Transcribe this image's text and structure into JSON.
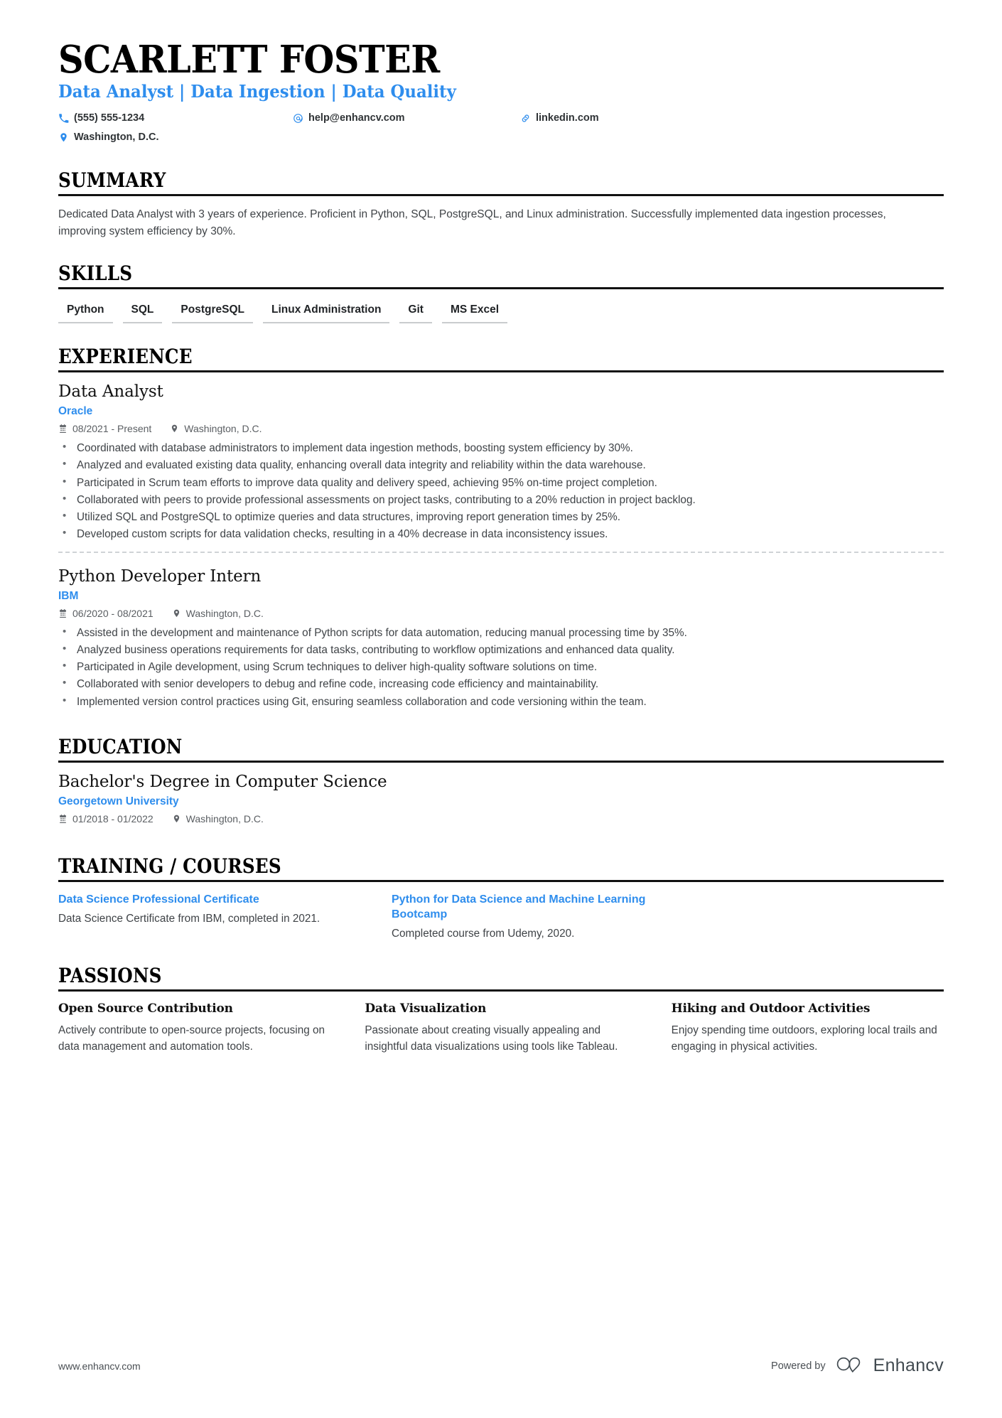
{
  "header": {
    "name": "SCARLETT FOSTER",
    "headline": "Data Analyst | Data Ingestion | Data Quality",
    "contacts": [
      {
        "icon": "phone-icon",
        "text": "(555) 555-1234"
      },
      {
        "icon": "email-icon",
        "text": "help@enhancv.com"
      },
      {
        "icon": "link-icon",
        "text": "linkedin.com"
      },
      {
        "icon": "location-icon",
        "text": "Washington, D.C."
      }
    ]
  },
  "summary": {
    "title": "SUMMARY",
    "text": "Dedicated Data Analyst with 3 years of experience. Proficient in Python, SQL, PostgreSQL, and Linux administration. Successfully implemented data ingestion processes, improving system efficiency by 30%."
  },
  "skills": {
    "title": "SKILLS",
    "items": [
      "Python",
      "SQL",
      "PostgreSQL",
      "Linux Administration",
      "Git",
      "MS Excel"
    ]
  },
  "experience": {
    "title": "EXPERIENCE",
    "entries": [
      {
        "role": "Data Analyst",
        "company": "Oracle",
        "dates": "08/2021 - Present",
        "location": "Washington, D.C.",
        "bullets": [
          "Coordinated with database administrators to implement data ingestion methods, boosting system efficiency by 30%.",
          "Analyzed and evaluated existing data quality, enhancing overall data integrity and reliability within the data warehouse.",
          "Participated in Scrum team efforts to improve data quality and delivery speed, achieving 95% on-time project completion.",
          "Collaborated with peers to provide professional assessments on project tasks, contributing to a 20% reduction in project backlog.",
          "Utilized SQL and PostgreSQL to optimize queries and data structures, improving report generation times by 25%.",
          "Developed custom scripts for data validation checks, resulting in a 40% decrease in data inconsistency issues."
        ]
      },
      {
        "role": "Python Developer Intern",
        "company": "IBM",
        "dates": "06/2020 - 08/2021",
        "location": "Washington, D.C.",
        "bullets": [
          "Assisted in the development and maintenance of Python scripts for data automation, reducing manual processing time by 35%.",
          "Analyzed business operations requirements for data tasks, contributing to workflow optimizations and enhanced data quality.",
          "Participated in Agile development, using Scrum techniques to deliver high-quality software solutions on time.",
          "Collaborated with senior developers to debug and refine code, increasing code efficiency and maintainability.",
          "Implemented version control practices using Git, ensuring seamless collaboration and code versioning within the team."
        ]
      }
    ]
  },
  "education": {
    "title": "EDUCATION",
    "entries": [
      {
        "degree": "Bachelor's Degree in Computer Science",
        "school": "Georgetown University",
        "dates": "01/2018 - 01/2022",
        "location": "Washington, D.C."
      }
    ]
  },
  "training": {
    "title": "TRAINING / COURSES",
    "items": [
      {
        "name": "Data Science Professional Certificate",
        "description": "Data Science Certificate from IBM, completed in 2021."
      },
      {
        "name": "Python for Data Science and Machine Learning Bootcamp",
        "description": "Completed course from Udemy, 2020."
      }
    ]
  },
  "passions": {
    "title": "PASSIONS",
    "items": [
      {
        "name": "Open Source Contribution",
        "description": "Actively contribute to open-source projects, focusing on data management and automation tools."
      },
      {
        "name": "Data Visualization",
        "description": "Passionate about creating visually appealing and insightful data visualizations using tools like Tableau."
      },
      {
        "name": "Hiking and Outdoor Activities",
        "description": "Enjoy spending time outdoors, exploring local trails and engaging in physical activities."
      }
    ]
  },
  "footer": {
    "url": "www.enhancv.com",
    "powered_by": "Powered by",
    "brand": "Enhancv"
  },
  "colors": {
    "accent": "#2e8ded",
    "ink": "#000000",
    "body": "#3f4347"
  }
}
